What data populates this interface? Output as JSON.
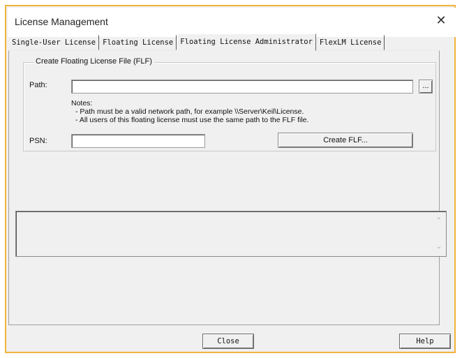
{
  "window": {
    "title": "License Management",
    "close_glyph": "✕"
  },
  "tabs": [
    {
      "label": "Single-User License"
    },
    {
      "label": "Floating License"
    },
    {
      "label": "Floating License Administrator"
    },
    {
      "label": "FlexLM License"
    }
  ],
  "active_tab": "Floating License Administrator",
  "flf_group": {
    "legend": "Create Floating License File (FLF)",
    "path_label": "Path:",
    "path_value": "",
    "browse_label": "...",
    "notes_title": "Notes:",
    "note_1": "- Path must be a valid network path, for example \\\\Server\\Keil\\License.",
    "note_2": "- All users of this floating license must use the same path to the FLF file.",
    "psn_label": "PSN:",
    "psn_value": "",
    "create_label": "Create FLF..."
  },
  "status_box": {
    "text": "",
    "scroll_up_glyph": "⌃",
    "scroll_down_glyph": "⌄"
  },
  "footer": {
    "close_label": "Close",
    "help_label": "Help"
  },
  "colors": {
    "accent_border": "#f2b33c",
    "dialog_bg": "#f0f0f0"
  }
}
